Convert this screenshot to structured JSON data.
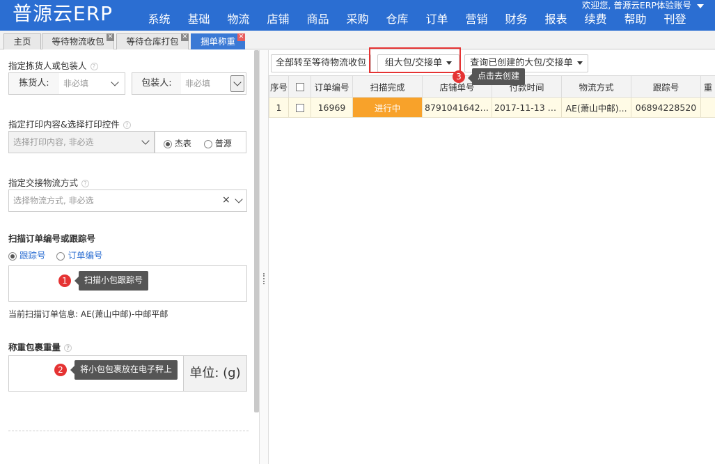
{
  "header": {
    "logo": "普源云ERP",
    "nav": [
      "系统",
      "基础",
      "物流",
      "店铺",
      "商品",
      "采购",
      "仓库",
      "订单",
      "营销",
      "财务",
      "报表",
      "续费",
      "帮助",
      "刊登"
    ],
    "user": "欢迎您, 普源云ERP体验账号"
  },
  "tabs": [
    {
      "label": "主页"
    },
    {
      "label": "等待物流收包"
    },
    {
      "label": "等待仓库打包"
    },
    {
      "label": "捆单称重"
    }
  ],
  "left": {
    "picker_section": "指定拣货人或包装人",
    "picker_label": "拣货人:",
    "picker_placeholder": "非必填",
    "packer_label": "包装人:",
    "packer_placeholder": "非必填",
    "print_section": "指定打印内容&选择打印控件",
    "print_placeholder": "选择打印内容, 非必选",
    "print_opt1": "杰表",
    "print_opt2": "普源",
    "logistics_section": "指定交接物流方式",
    "logistics_placeholder": "选择物流方式, 非必选",
    "logistics_clear": "×",
    "scan_section": "扫描订单编号或跟踪号",
    "scan_opt1": "跟踪号",
    "scan_opt2": "订单编号",
    "tip1_num": "1",
    "tip1": "扫描小包跟踪号",
    "scan_info": "当前扫描订单信息: AE(萧山中邮)-中邮平邮",
    "weight_section": "称重包裹重量",
    "tip2_num": "2",
    "tip2": "将小包包裹放在电子秤上",
    "unit": "单位: (g)"
  },
  "toolbar": {
    "btn1": "全部转至等待物流收包",
    "btn2": "组大包/交接单",
    "btn3": "查询已创建的大包/交接单",
    "tip3_num": "3",
    "tip3": "点击去创建"
  },
  "table": {
    "columns": [
      "序号",
      "",
      "订单编号",
      "扫描完成",
      "店铺单号",
      "付款时间",
      "物流方式",
      "跟踪号",
      "重"
    ],
    "rows": [
      {
        "seq": "1",
        "order": "16969",
        "status": "进行中",
        "shop": "87910416428...",
        "paid": "2017-11-13 2...",
        "logistics": "AE(萧山中邮)...",
        "track": "06894228520"
      }
    ]
  }
}
